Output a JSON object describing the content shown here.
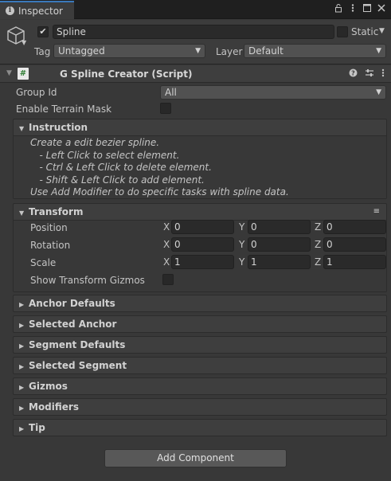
{
  "window": {
    "tab_label": "Inspector",
    "tab_icon": "info-icon",
    "controls": [
      "lock-icon",
      "menu-icon",
      "maximize-icon",
      "close-icon"
    ]
  },
  "object": {
    "active": true,
    "name": "Spline",
    "static_label": "Static",
    "static_checked": false,
    "tag_label": "Tag",
    "tag_value": "Untagged",
    "layer_label": "Layer",
    "layer_value": "Default"
  },
  "component": {
    "title": "G Spline Creator (Script)",
    "icon": "csharp-script-icon",
    "tools": [
      "help-icon",
      "preset-icon",
      "context-menu-icon"
    ],
    "group_id_label": "Group Id",
    "group_id_value": "All",
    "terrain_mask_label": "Enable Terrain Mask",
    "terrain_mask_checked": false
  },
  "instruction": {
    "title": "Instruction",
    "lines": [
      "Create a edit bezier spline.",
      "   - Left Click to select element.",
      "   - Ctrl & Left Click to delete element.",
      "   - Shift & Left Click to add element.",
      "Use Add Modifier to do specific tasks with spline data."
    ]
  },
  "transform": {
    "title": "Transform",
    "rows": [
      {
        "label": "Position",
        "x": "0",
        "y": "0",
        "z": "0"
      },
      {
        "label": "Rotation",
        "x": "0",
        "y": "0",
        "z": "0"
      },
      {
        "label": "Scale",
        "x": "1",
        "y": "1",
        "z": "1"
      }
    ],
    "axis_labels": {
      "x": "X",
      "y": "Y",
      "z": "Z"
    },
    "gizmos_label": "Show Transform Gizmos",
    "gizmos_checked": false
  },
  "sections": [
    "Anchor Defaults",
    "Selected Anchor",
    "Segment Defaults",
    "Selected Segment",
    "Gizmos",
    "Modifiers",
    "Tip"
  ],
  "add_component_label": "Add Component",
  "colors": {
    "background": "#383838",
    "tab_accent": "#3a79bb",
    "script_icon_green": "#2e7d32"
  }
}
